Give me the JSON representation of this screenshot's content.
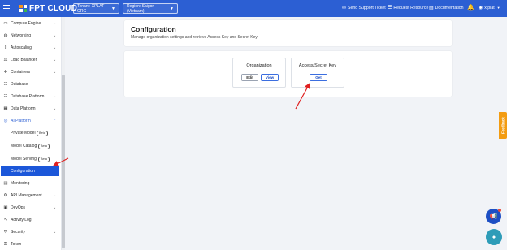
{
  "topbar": {
    "brand": "FPT CLOUD",
    "tenant": "Tenant: XPLAT-ORG",
    "region": "Region: Saigon (Vietnam)",
    "send_support": "Send Support Ticket",
    "request_resource": "Request Resource",
    "documentation": "Documentation",
    "user": "x.plat"
  },
  "sidebar": {
    "items": [
      {
        "label": "Compute Engine",
        "icon": "monitor-icon"
      },
      {
        "label": "Networking",
        "icon": "globe-icon"
      },
      {
        "label": "Autoscaling",
        "icon": "autoscale-icon"
      },
      {
        "label": "Load Balancer",
        "icon": "balance-icon"
      },
      {
        "label": "Containers",
        "icon": "container-icon"
      },
      {
        "label": "Database",
        "icon": "database-icon"
      },
      {
        "label": "Database Platform",
        "icon": "database-platform-icon"
      },
      {
        "label": "Data Platform",
        "icon": "data-platform-icon"
      },
      {
        "label": "AI Platform",
        "icon": "ai-icon"
      },
      {
        "label": "Private Model",
        "badge": "Beta"
      },
      {
        "label": "Model Catalog",
        "badge": "Beta"
      },
      {
        "label": "Model Serving",
        "badge": "Beta"
      },
      {
        "label": "Configuration"
      },
      {
        "label": "Monitoring",
        "icon": "monitoring-icon"
      },
      {
        "label": "API Management",
        "icon": "api-icon"
      },
      {
        "label": "DevOps",
        "icon": "devops-icon"
      },
      {
        "label": "Activity Log",
        "icon": "activity-icon"
      },
      {
        "label": "Security",
        "icon": "shield-icon"
      },
      {
        "label": "Token",
        "icon": "key-icon"
      }
    ]
  },
  "page": {
    "title": "Configuration",
    "description": "Manage organization settings and retrieve Access Key and Secret Key"
  },
  "organization": {
    "title": "Organization",
    "edit": "Edit",
    "view": "View"
  },
  "access_key": {
    "title": "Access/Secret Key",
    "get": "Get"
  },
  "feedback": "Feedback",
  "colors": {
    "primary": "#2c5fd3",
    "active": "#1c57d9",
    "feedback": "#f39c12",
    "annotation": "#e02020"
  }
}
